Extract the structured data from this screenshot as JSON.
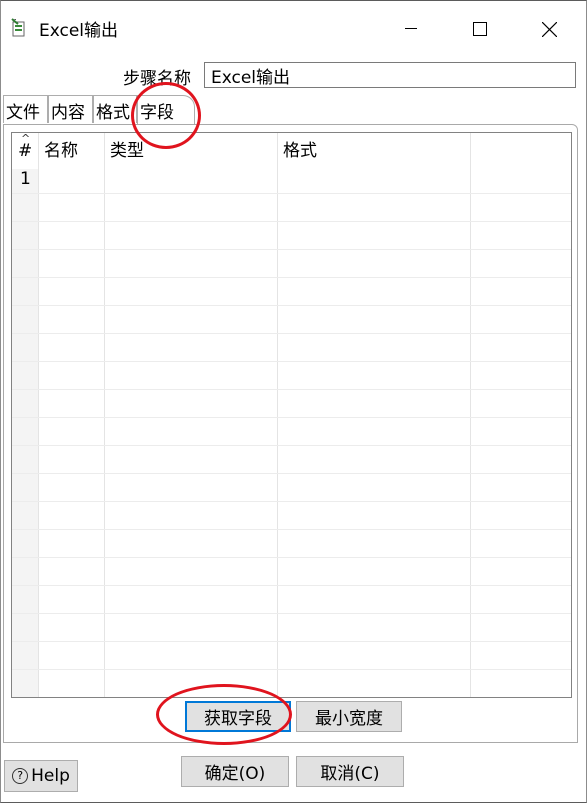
{
  "window": {
    "title": "Excel输出"
  },
  "step": {
    "label": "步骤名称",
    "value": "Excel输出"
  },
  "tabs": [
    {
      "label": "文件"
    },
    {
      "label": "内容"
    },
    {
      "label": "格式"
    },
    {
      "label": "字段"
    }
  ],
  "active_tab": "字段",
  "grid": {
    "headers": {
      "num": "#",
      "name": "名称",
      "type": "类型",
      "format": "格式"
    },
    "rows": [
      {
        "num": "1"
      }
    ]
  },
  "buttons": {
    "get_fields": "获取字段",
    "min_width": "最小宽度",
    "ok": "确定(O)",
    "cancel": "取消(C)",
    "help": "Help"
  },
  "colors": {
    "annotation": "#e0141e",
    "focus": "#0078d7",
    "button_bg": "#e1e1e1"
  }
}
